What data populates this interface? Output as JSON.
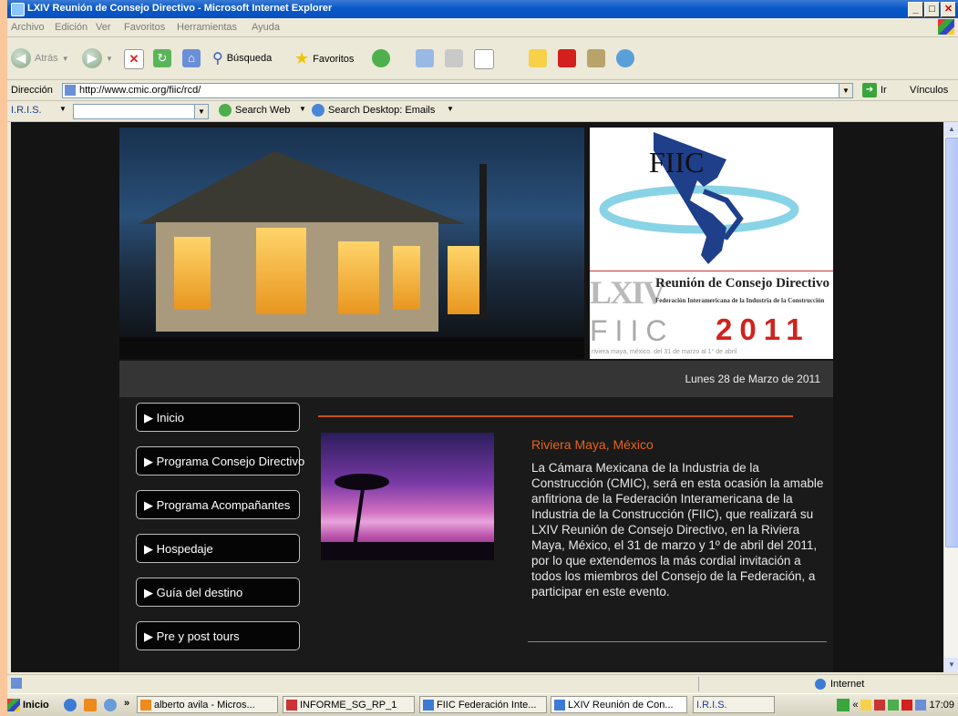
{
  "window": {
    "title": "LXIV Reunión de Consejo Directivo - Microsoft Internet Explorer",
    "buttons": [
      "_",
      "□",
      "✕"
    ]
  },
  "menubar": [
    "Archivo",
    "Edición",
    "Ver",
    "Favoritos",
    "Herramientas",
    "Ayuda"
  ],
  "toolbar": {
    "back_label": "Atrás",
    "search_label": "Búsqueda",
    "favorites_label": "Favoritos"
  },
  "address": {
    "label": "Dirección",
    "url": "http://www.cmic.org/fiic/rcd/",
    "go_label": "Ir",
    "links_label": "Vínculos"
  },
  "iris_bar": {
    "brand": "I.R.I.S.",
    "search_web": "Search Web",
    "search_desktop": "Search Desktop: Emails"
  },
  "page": {
    "logo": {
      "fiic": "FIIC",
      "lxiv": "LXIV",
      "title": "Reunión de Consejo Directivo",
      "federation": "Federación Interamericana de la Industria de la Construcción",
      "fiic_big": "FIIC",
      "year": "2011",
      "location": "riviera maya, méxico. del 31 de marzo al 1° de abril"
    },
    "date": "Lunes 28 de Marzo de 2011",
    "nav": [
      {
        "label": "▶ Inicio"
      },
      {
        "label": "▶ Programa Consejo Directivo"
      },
      {
        "label": "▶ Programa Acompañantes"
      },
      {
        "label": "▶ Hospedaje"
      },
      {
        "label": "▶ Guía del destino"
      },
      {
        "label": "▶ Pre y post tours"
      }
    ],
    "content_title": "Riviera Maya, México",
    "content_text": "La Cámara Mexicana de la Industria de la Construcción (CMIC), será en esta ocasión la amable anfitriona de la Federación Interamericana de la Industria de la Construcción (FIIC), que realizará su LXIV Reunión de Consejo Directivo, en la Riviera Maya, México, el 31 de marzo y 1º de abril del 2011, por lo que extendemos la más cordial invitación a todos los miembros del Consejo de la Federación, a participar en este evento."
  },
  "statusbar": {
    "zone": "Internet"
  },
  "taskbar": {
    "start": "Inicio",
    "chevron": "»",
    "tasks": [
      "alberto avila - Micros...",
      "INFORME_SG_RP_1",
      "FIIC Federación Inte...",
      "LXIV Reunión de Con...",
      "I.R.I.S."
    ],
    "tray_chevron": "«",
    "clock": "17:09"
  }
}
